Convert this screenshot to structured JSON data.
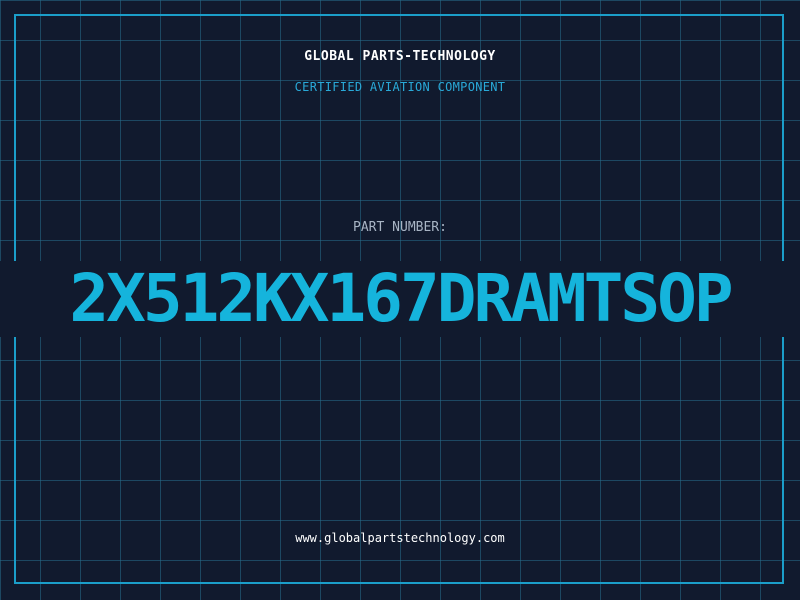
{
  "header": {
    "company": "GLOBAL PARTS-TECHNOLOGY",
    "tagline": "CERTIFIED AVIATION COMPONENT"
  },
  "part": {
    "label": "PART NUMBER:",
    "number": "2X512KX167DRAMTSOP"
  },
  "footer": {
    "url": "www.globalpartstechnology.com"
  },
  "colors": {
    "background": "#111a2e",
    "grid": "#266e8c",
    "accent": "#15b4dc",
    "frame": "#1b9ec9"
  }
}
